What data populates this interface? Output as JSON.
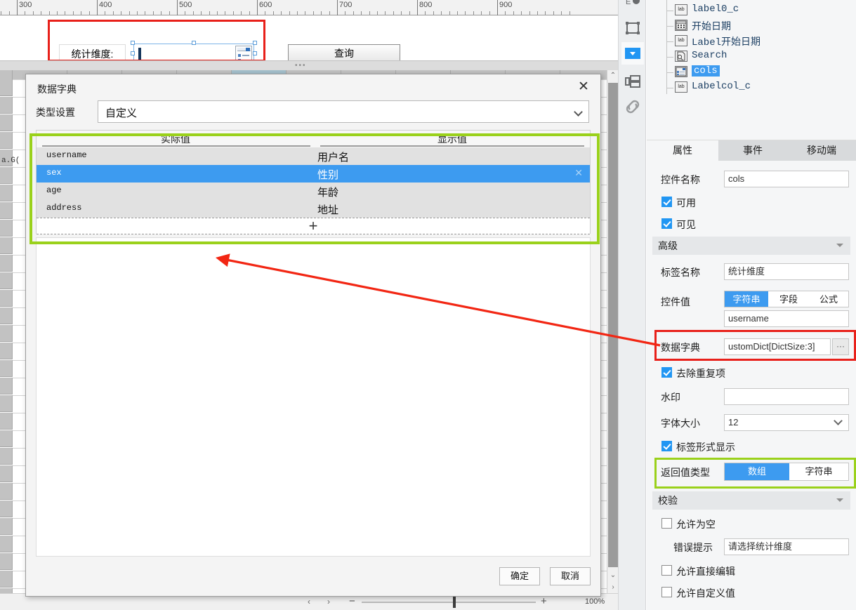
{
  "designer": {
    "ruler": {
      "labels": [
        "300",
        "400",
        "500",
        "600",
        "700",
        "800",
        "900"
      ]
    },
    "form": {
      "dimension_label": "统计维度:",
      "combo_value": "",
      "query_button": "查询"
    },
    "grid": {
      "formula_cell": "a.G("
    },
    "statusbar": {
      "prev_arrow": "‹",
      "next_arrow": "›",
      "zoom_out": "−",
      "zoom_in": "+",
      "zoom_level": "100%",
      "expand_arrow": "›"
    }
  },
  "toolstrip": {
    "items": [
      {
        "name": "frame-icon"
      },
      {
        "name": "dropdown-icon"
      },
      {
        "name": "layout-icon"
      },
      {
        "name": "link-icon"
      }
    ]
  },
  "dialog": {
    "title": "数据字典",
    "close": "✕",
    "type_setting_label": "类型设置",
    "type_setting_value": "自定义",
    "table": {
      "headers": [
        "实际值",
        "显示值"
      ],
      "rows": [
        {
          "actual": "username",
          "display": "用户名",
          "selected": false
        },
        {
          "actual": "sex",
          "display": "性别",
          "selected": true
        },
        {
          "actual": "age",
          "display": "年龄",
          "selected": false
        },
        {
          "actual": "address",
          "display": "地址",
          "selected": false
        }
      ],
      "add_row_label": "+",
      "delete_icon": "✕"
    },
    "ok_button": "确定",
    "cancel_button": "取消"
  },
  "tree": {
    "items": [
      {
        "icon": "lab",
        "label": "label0_c",
        "selected": false
      },
      {
        "icon": "cal",
        "label": "开始日期",
        "selected": false
      },
      {
        "icon": "lab",
        "label": "Label开始日期",
        "selected": false
      },
      {
        "icon": "srch",
        "label": "Search",
        "selected": false
      },
      {
        "icon": "combo",
        "label": "cols",
        "selected": true
      },
      {
        "icon": "lab",
        "label": "Labelcol_c",
        "selected": false
      }
    ]
  },
  "panel": {
    "tabs": [
      {
        "label": "属性",
        "active": true
      },
      {
        "label": "事件",
        "active": false
      },
      {
        "label": "移动端",
        "active": false
      }
    ],
    "widget_name_label": "控件名称",
    "widget_name_value": "cols",
    "enabled_label": "可用",
    "enabled_checked": true,
    "visible_label": "可见",
    "visible_checked": true,
    "advanced_section": "高级",
    "tag_name_label": "标签名称",
    "tag_name_value": "统计维度",
    "widget_value_label": "控件值",
    "widget_value_modes": [
      {
        "label": "字符串",
        "on": true
      },
      {
        "label": "字段",
        "on": false
      },
      {
        "label": "公式",
        "on": false
      }
    ],
    "widget_value_text": "username",
    "data_dict_label": "数据字典",
    "data_dict_value": "ustomDict[DictSize:3]",
    "data_dict_more": "···",
    "dedupe_label": "去除重复项",
    "dedupe_checked": true,
    "watermark_label": "水印",
    "watermark_value": "",
    "font_size_label": "字体大小",
    "font_size_value": "12",
    "tag_display_label": "标签形式显示",
    "tag_display_checked": true,
    "return_type_label": "返回值类型",
    "return_type_options": [
      {
        "label": "数组",
        "on": true
      },
      {
        "label": "字符串",
        "on": false
      }
    ],
    "validation_section": "校验",
    "allow_empty_label": "允许为空",
    "allow_empty_checked": false,
    "error_tip_label": "错误提示",
    "error_tip_value": "请选择统计维度",
    "allow_direct_edit_label": "允许直接编辑",
    "allow_direct_edit_checked": false,
    "allow_custom_value_label": "允许自定义值",
    "allow_custom_value_checked": false
  },
  "annotations": {
    "highlight_red": "#e8201a",
    "highlight_green": "#9ad11b",
    "arrow_color": "#f22613"
  }
}
